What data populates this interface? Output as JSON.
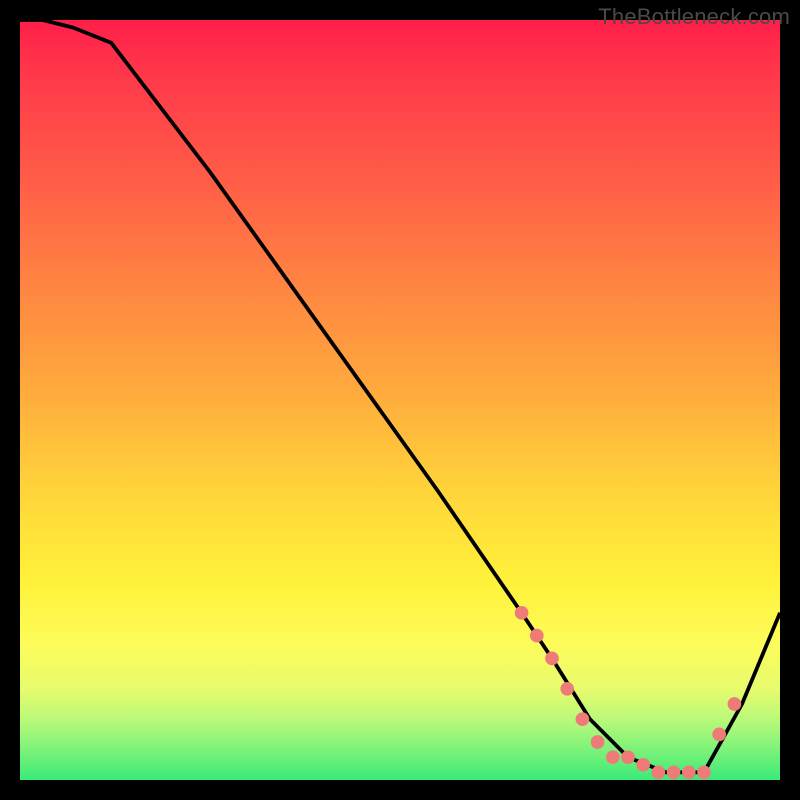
{
  "watermark": "TheBottleneck.com",
  "chart_data": {
    "type": "line",
    "title": "",
    "subtitle": "",
    "xlabel": "",
    "ylabel": "",
    "xlim": [
      0,
      100
    ],
    "ylim": [
      0,
      100
    ],
    "grid": false,
    "background": "rainbow-gradient-vertical",
    "series": [
      {
        "name": "curve",
        "color": "#000000",
        "type": "line",
        "x": [
          0,
          3,
          7,
          12,
          25,
          40,
          55,
          66,
          70,
          75,
          80,
          85,
          90,
          95,
          100
        ],
        "y": [
          100,
          100,
          99,
          97,
          80,
          59,
          38,
          22,
          16,
          8,
          3,
          1,
          1,
          10,
          22
        ]
      },
      {
        "name": "highlight-points",
        "color": "#ef7b78",
        "type": "scatter",
        "x": [
          66,
          68,
          70,
          72,
          74,
          76,
          78,
          80,
          82,
          84,
          86,
          88,
          90,
          92,
          94
        ],
        "y": [
          22,
          19,
          16,
          12,
          8,
          5,
          3,
          3,
          2,
          1,
          1,
          1,
          1,
          6,
          10
        ]
      }
    ],
    "annotations": []
  },
  "colors": {
    "frame": "#000000",
    "watermark": "#4a4a4a",
    "curve": "#000000",
    "markers": "#ef7b78"
  }
}
